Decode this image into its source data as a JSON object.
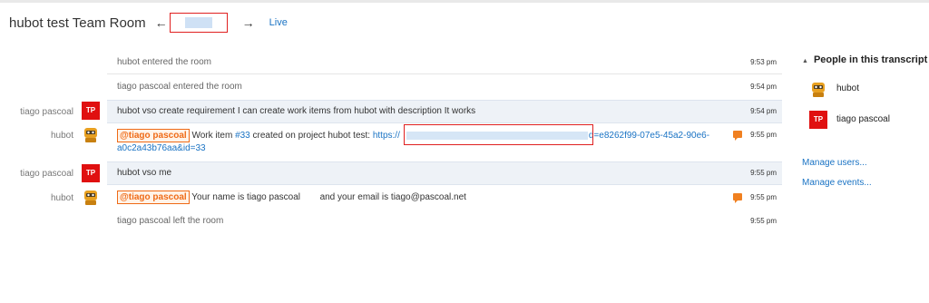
{
  "header": {
    "room_title": "hubot test Team Room",
    "prev_arrow": "←",
    "next_arrow": "→",
    "live_label": "Live"
  },
  "messages": [
    {
      "sender": "",
      "avatar": "",
      "text": "hubot entered the room",
      "time": "9:53 pm",
      "kind": "system"
    },
    {
      "sender": "",
      "avatar": "",
      "text": "tiago pascoal entered the room",
      "time": "9:54 pm",
      "kind": "system"
    },
    {
      "sender": "tiago pascoal",
      "avatar": "TP",
      "text": "hubot vso create requirement I can create work items from hubot with description It works",
      "time": "9:54 pm",
      "kind": "user"
    },
    {
      "sender": "hubot",
      "avatar": "bot",
      "mention": "@tiago pascoal",
      "text_a": "Work item",
      "item_link": "#33",
      "text_b": "created on project hubot test:",
      "url_start": "https://",
      "url_end": "d=e8262f99-07e5-45a2-90e6-",
      "url_line2": "a0c2a43b76aa&id=33",
      "time": "9:55 pm",
      "kind": "bot"
    },
    {
      "sender": "tiago pascoal",
      "avatar": "TP",
      "text": "hubot vso me",
      "time": "9:55 pm",
      "kind": "user"
    },
    {
      "sender": "hubot",
      "avatar": "bot",
      "mention": "@tiago pascoal",
      "text_a": "Your name is tiago pascoal",
      "text_b": "and your email is tiago@pascoal.net",
      "time": "9:55 pm",
      "kind": "bot"
    },
    {
      "sender": "",
      "avatar": "",
      "text": "tiago pascoal left the room",
      "time": "9:55 pm",
      "kind": "system"
    }
  ],
  "sidebar": {
    "heading": "People in this transcript",
    "people": [
      {
        "name": "hubot",
        "avatar": "bot"
      },
      {
        "name": "tiago pascoal",
        "avatar": "TP"
      }
    ],
    "manage_users": "Manage users...",
    "manage_events": "Manage events..."
  },
  "colors": {
    "accent_link": "#1a73c4",
    "avatar_red": "#e01010",
    "mention_orange": "#ef6a16",
    "shaded_row": "#eef2f7"
  }
}
